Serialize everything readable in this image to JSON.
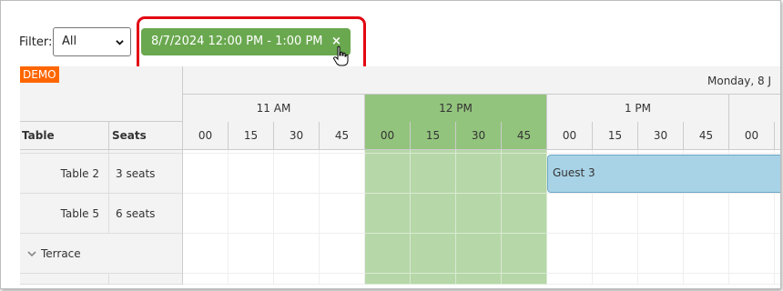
{
  "filter": {
    "label": "Filter:",
    "selected": "All"
  },
  "chip": {
    "text": "8/7/2024 12:00 PM - 1:00 PM",
    "close": "×"
  },
  "demo_badge": "DEMO",
  "header": {
    "date": "Monday, 8 J",
    "col_table": "Table",
    "col_seats": "Seats",
    "hours": [
      "11 AM",
      "12 PM",
      "1 PM"
    ],
    "minutes": [
      "00",
      "15",
      "30",
      "45",
      "00",
      "15",
      "30",
      "45",
      "00",
      "15",
      "30",
      "45",
      "00"
    ]
  },
  "rows": [
    {
      "name": "Table 2",
      "seats": "3 seats"
    },
    {
      "name": "Table 5",
      "seats": "6 seats"
    },
    {
      "name": "Terrace",
      "seats": ""
    }
  ],
  "events": [
    {
      "text": "Guest 3"
    }
  ],
  "colors": {
    "accent": "#6aa84f",
    "selection": "#b6d7a8",
    "selection_header": "#93c47d",
    "event": "#a8d3e6",
    "highlight": "#e30613",
    "demo": "#ff6600"
  }
}
